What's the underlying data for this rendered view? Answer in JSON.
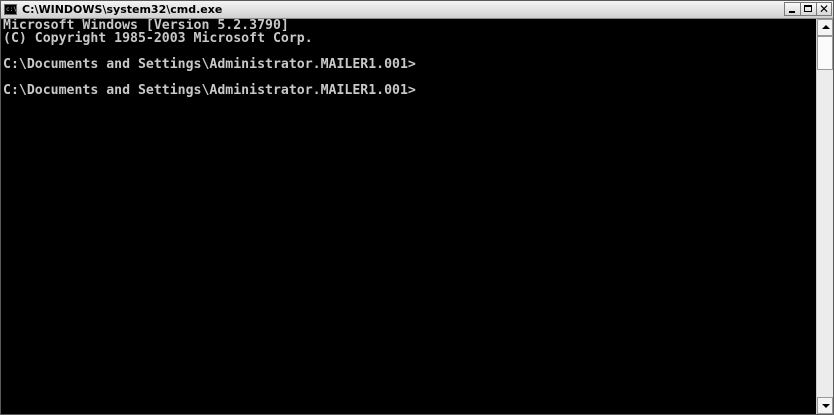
{
  "window": {
    "title": "C:\\WINDOWS\\system32\\cmd.exe",
    "icon_text": "c:\\",
    "controls": {
      "minimize": "_",
      "maximize": "□",
      "close": "✕"
    }
  },
  "console": {
    "lines": [
      "Microsoft Windows [Version 5.2.3790]",
      "(C) Copyright 1985-2003 Microsoft Corp.",
      "",
      "C:\\Documents and Settings\\Administrator.MAILER1.001>",
      "",
      "C:\\Documents and Settings\\Administrator.MAILER1.001>"
    ],
    "text_color": "#c8c8c8",
    "background_color": "#000000"
  }
}
